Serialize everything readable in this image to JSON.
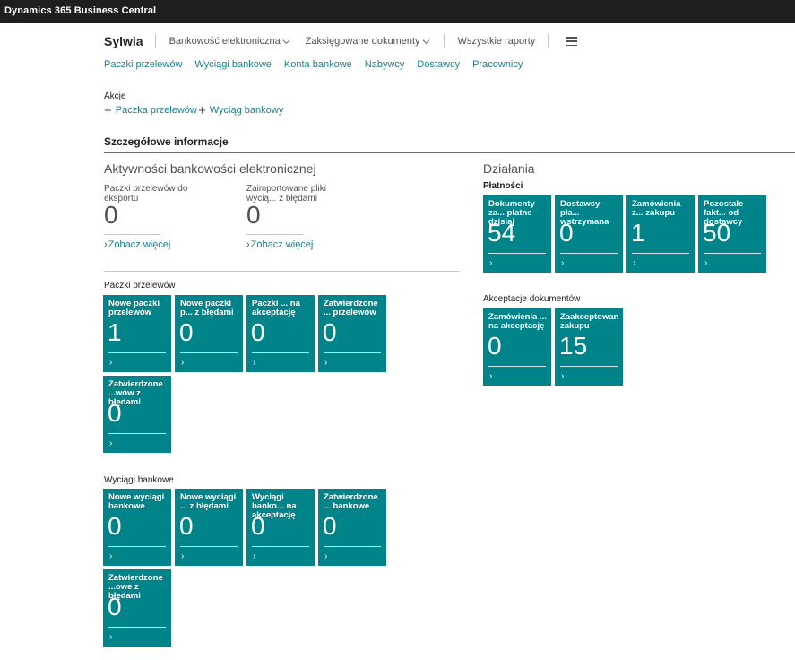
{
  "app": {
    "title": "Dynamics 365 Business Central"
  },
  "nav": {
    "profile": "Sylwia",
    "menu": [
      {
        "label": "Bankowość elektroniczna"
      },
      {
        "label": "Zaksięgowane dokumenty"
      },
      {
        "label": "Wszystkie raporty"
      }
    ],
    "links": [
      "Paczki przelewów",
      "Wyciągi bankowe",
      "Konta bankowe",
      "Nabywcy",
      "Dostawcy",
      "Pracownicy"
    ]
  },
  "actions": {
    "label": "Akcje",
    "items": [
      "Paczka przelewów",
      "Wyciąg bankowy"
    ]
  },
  "details": {
    "title": "Szczegółowe informacje",
    "activities": {
      "title": "Aktywności bankowości elektronicznej",
      "cues": [
        {
          "label": "Paczki przelewów do eksportu",
          "value": "0",
          "link": "Zobacz więcej"
        },
        {
          "label": "Zaimportowane pliki wyciągów z błędami",
          "label_shown": "Zaimportowane pliki wycią... z błędami",
          "value": "0",
          "link": "Zobacz więcej"
        }
      ]
    },
    "payment_batches": {
      "title": "Paczki przelewów",
      "tiles": [
        {
          "label": "Nowe paczki przelewów",
          "value": "1"
        },
        {
          "label": "Nowe paczki p... z błędami",
          "value": "0"
        },
        {
          "label": "Paczki ... na akceptację",
          "value": "0"
        },
        {
          "label": "Zatwierdzone ... przelewów",
          "value": "0"
        },
        {
          "label": "Zatwierdzone ...wów z błędami",
          "value": "0"
        }
      ]
    },
    "bank_statements": {
      "title": "Wyciągi bankowe",
      "tiles": [
        {
          "label": "Nowe wyciągi bankowe",
          "value": "0"
        },
        {
          "label": "Nowe wyciągi ... z błędami",
          "value": "0"
        },
        {
          "label": "Wyciągi banko... na akceptację",
          "value": "0"
        },
        {
          "label": "Zatwierdzone ... bankowe",
          "value": "0"
        },
        {
          "label": "Zatwierdzone ...owe z błędami",
          "value": "0"
        }
      ]
    },
    "operations": {
      "title": "Działania",
      "payments": {
        "title": "Płatności",
        "tiles": [
          {
            "label": "Dokumenty za... płatne dzisiaj",
            "value": "54"
          },
          {
            "label": "Dostawcy - pła... wstrzymana",
            "value": "0"
          },
          {
            "label": "Zamówienia z... zakupu",
            "value": "1"
          },
          {
            "label": "Pozostałe fakt... od dostawcy",
            "value": "50"
          }
        ]
      },
      "approvals": {
        "title": "Akceptacje dokumentów",
        "tiles": [
          {
            "label": "Zamówienia ... na akceptację",
            "value": "0"
          },
          {
            "label": "Zaakceptowan... zakupu",
            "value": "15"
          }
        ]
      }
    }
  },
  "colors": {
    "tile": "#008489",
    "link": "#1a7f8a",
    "topbar": "#1f1f1f"
  },
  "icons": {
    "chevron": "chevron-down-icon",
    "menu": "hamburger-icon",
    "add": "plus-icon",
    "arrow": "chevron-right-icon"
  }
}
